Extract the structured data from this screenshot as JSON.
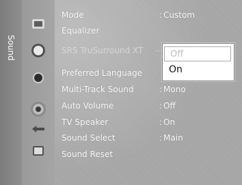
{
  "sidebar": {
    "title": "Sound",
    "icons": [
      "picture-icon",
      "sound-icon",
      "channel-icon",
      "setup-icon",
      "input-icon",
      "application-icon"
    ]
  },
  "menu": {
    "items": [
      {
        "label": "Mode",
        "value": "Custom"
      },
      {
        "label": "Equalizer",
        "value": ""
      },
      {
        "label": "SRS TruSurround XT",
        "value": ""
      },
      {
        "label": "Preferred Language",
        "value": ""
      },
      {
        "label": "Multi-Track Sound",
        "value": "Mono"
      },
      {
        "label": "Auto Volume",
        "value": "Off"
      },
      {
        "label": "TV Speaker",
        "value": "On"
      },
      {
        "label": "Sound Select",
        "value": "Main"
      },
      {
        "label": "Sound Reset",
        "value": ""
      }
    ]
  },
  "popup": {
    "options": [
      "Off",
      "On"
    ],
    "selected": "On"
  }
}
